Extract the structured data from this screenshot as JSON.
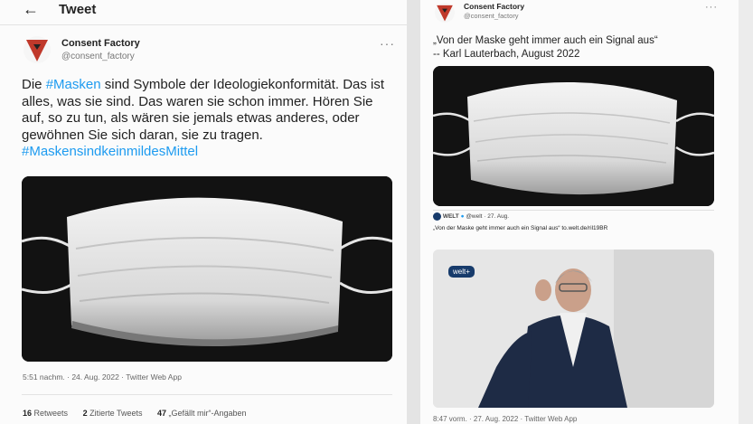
{
  "left_tweet": {
    "back_icon": "arrow-left-icon",
    "header_title": "Tweet",
    "author": {
      "name": "Consent Factory",
      "handle": "@consent_factory"
    },
    "more_label": "···",
    "text": {
      "w1": "Die ",
      "hashtag1": "#Masken",
      "w2": " sind Symbole der Ideologiekonformität. Das ist alles, was sie sind. Das waren sie schon immer. Hören Sie auf, so zu tun, als wären sie jemals etwas anderes, oder gewöhnen Sie sich daran, sie zu tragen.",
      "hashtag2": "#MaskensindkeinmildesMittel"
    },
    "timestamp": "5:51 nachm. · 24. Aug. 2022 · Twitter Web App",
    "stats": {
      "retweets_count": "16",
      "retweets_label": "Retweets",
      "quotes_count": "2",
      "quotes_label": "Zitierte Tweets",
      "likes_count": "47",
      "likes_label": "„Gefällt mir“-Angaben"
    }
  },
  "right_tweet": {
    "author": {
      "name": "Consent Factory",
      "handle": "@consent_factory"
    },
    "more_label": "···",
    "quote_line1": "„Von der Maske geht immer auch ein Signal aus“",
    "quote_line2": "-- Karl Lauterbach, August 2022",
    "embed": {
      "source": "WELT",
      "source_handle": "@welt · 27. Aug.",
      "text": "„Von der Maske geht immer auch ein Signal aus“ to.welt.de/ril19BR",
      "badge": "welt+"
    },
    "timestamp": "8:47 vorm. · 27. Aug. 2022 · Twitter Web App"
  }
}
